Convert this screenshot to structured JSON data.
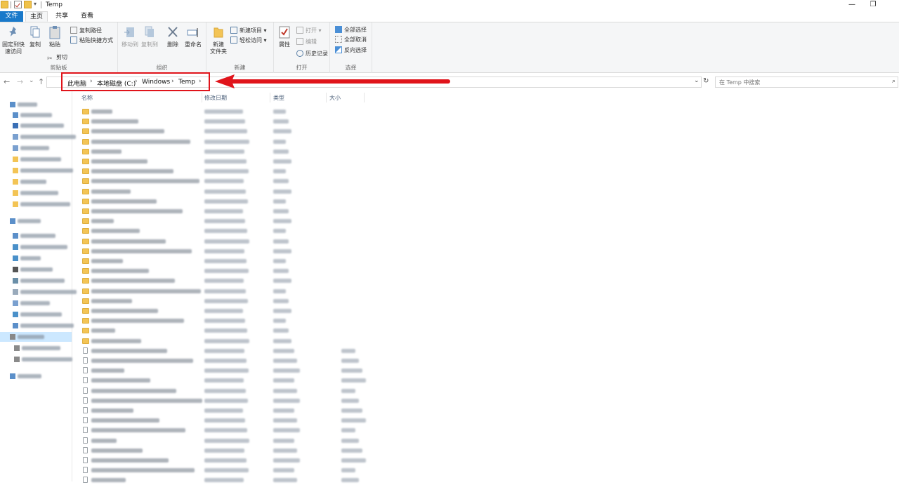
{
  "window": {
    "title": "Temp",
    "minimize_icon": "—",
    "restore_icon": "❐",
    "close_icon": "✕"
  },
  "tabs": [
    {
      "label": "文件",
      "active": false,
      "accent": "#1979ca"
    },
    {
      "label": "主页",
      "active": true
    },
    {
      "label": "共享",
      "active": false
    },
    {
      "label": "查看",
      "active": false
    }
  ],
  "ribbon": {
    "clipboard": {
      "label": "剪贴板",
      "pin": "固定到快\n速访问",
      "copy": "复制",
      "paste": "粘贴",
      "copy_path": "复制路径",
      "paste_shortcut": "粘贴快捷方式",
      "cut": "剪切"
    },
    "organize": {
      "label": "组织",
      "move_to": "移动到",
      "copy_to": "复制到",
      "delete": "删除",
      "rename": "重命名"
    },
    "new": {
      "label": "新建",
      "new_folder": "新建\n文件夹",
      "new_item": "新建项目",
      "easy_access": "轻松访问"
    },
    "open": {
      "label": "打开",
      "properties": "属性",
      "open": "打开",
      "edit": "编辑",
      "history": "历史记录"
    },
    "select": {
      "label": "选择",
      "select_all": "全部选择",
      "select_none": "全部取消",
      "invert": "反向选择"
    }
  },
  "address": {
    "back_icon": "←",
    "forward_icon": "→",
    "recent_icon": "⌄",
    "up_icon": "↑",
    "breadcrumbs": [
      "此电脑",
      "本地磁盘 (C:)",
      "Windows",
      "Temp"
    ],
    "separator": "›",
    "dropdown_icon": "⌄",
    "refresh_icon": "↻",
    "search_placeholder": "在 Temp 中搜索",
    "search_icon": "⌕"
  },
  "annotation": {
    "highlight_color": "#e0141b"
  },
  "columns": {
    "name": "名称",
    "modified": "修改日期",
    "type": "类型",
    "size": "大小"
  },
  "colors": {
    "accent": "#1979ca",
    "folder": "#f3c455",
    "selection": "#cce8ff",
    "annotation": "#e0141b"
  }
}
